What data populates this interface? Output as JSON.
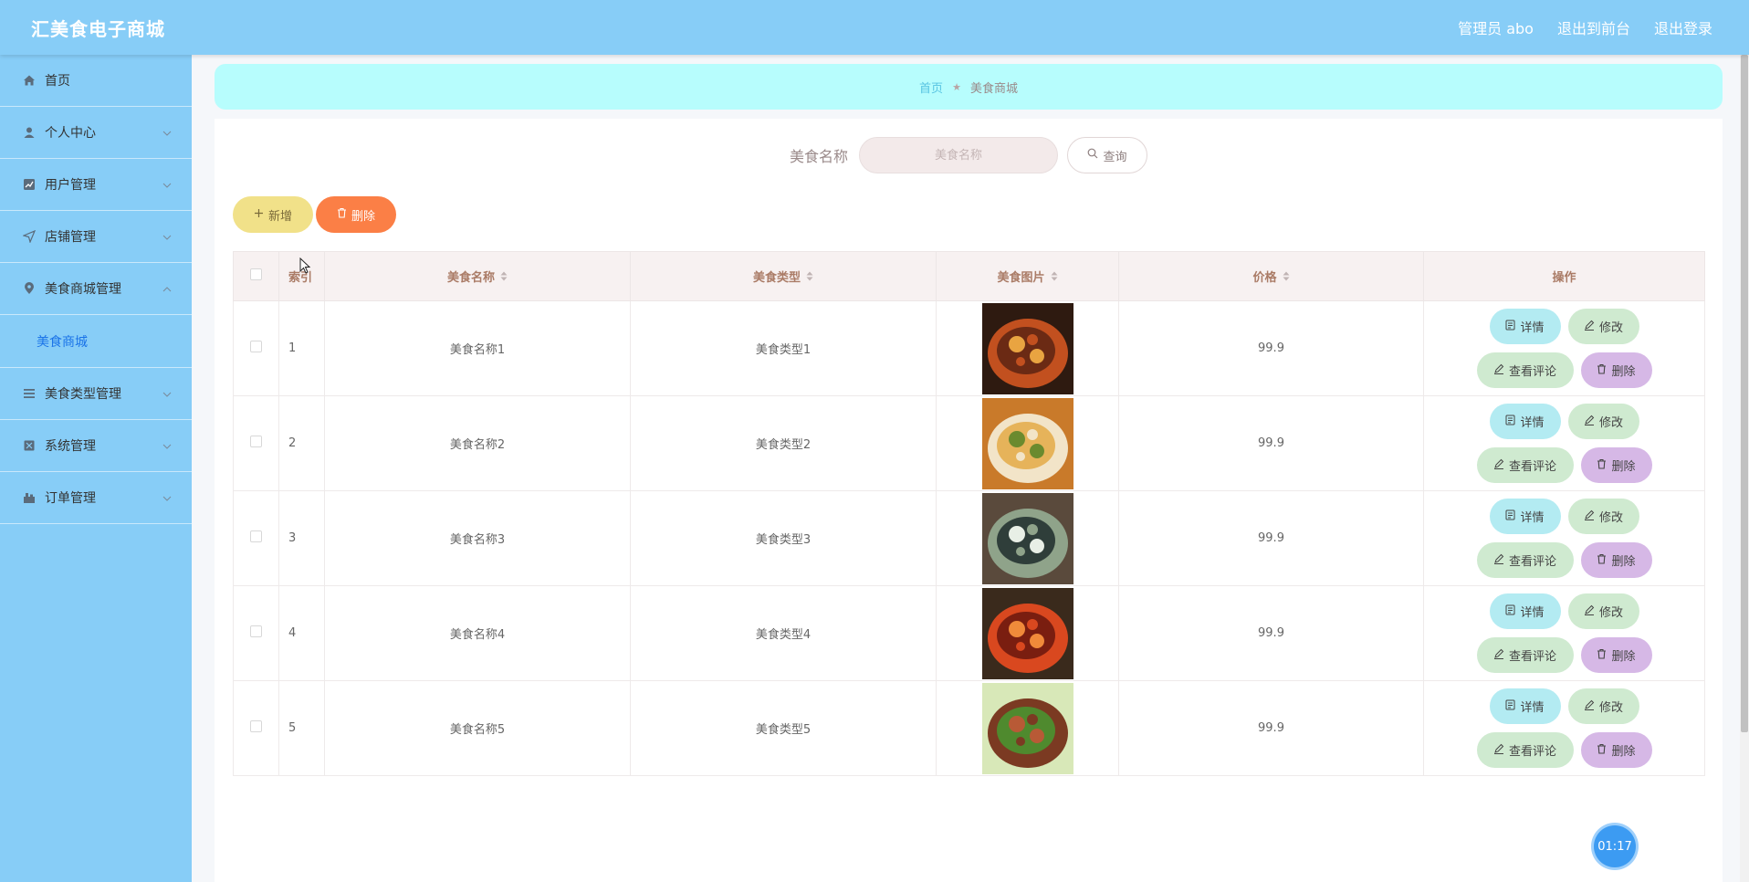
{
  "header": {
    "title": "汇美食电子商城",
    "admin_label": "管理员 abo",
    "to_front_label": "退出到前台",
    "logout_label": "退出登录"
  },
  "sidebar": {
    "items": [
      {
        "label": "首页",
        "icon": "home-icon"
      },
      {
        "label": "个人中心",
        "icon": "user-icon"
      },
      {
        "label": "用户管理",
        "icon": "chart-icon"
      },
      {
        "label": "店铺管理",
        "icon": "send-icon"
      },
      {
        "label": "美食商城管理",
        "icon": "location-icon",
        "expanded": true,
        "sub": "美食商城"
      },
      {
        "label": "美食类型管理",
        "icon": "menu-icon"
      },
      {
        "label": "系统管理",
        "icon": "box-icon"
      },
      {
        "label": "订单管理",
        "icon": "order-icon"
      }
    ]
  },
  "breadcrumb": {
    "home": "首页",
    "separator": "★",
    "current": "美食商城"
  },
  "search": {
    "label": "美食名称",
    "placeholder": "美食名称",
    "button_label": "查询"
  },
  "actions": {
    "add_label": "新增",
    "delete_label": "删除"
  },
  "table": {
    "headers": {
      "index": "索引",
      "name": "美食名称",
      "type": "美食类型",
      "image": "美食图片",
      "price": "价格",
      "ops": "操作"
    },
    "op_labels": {
      "detail": "详情",
      "edit": "修改",
      "comments": "查看评论",
      "delete": "删除"
    },
    "rows": [
      {
        "index": "1",
        "name": "美食名称1",
        "type": "美食类型1",
        "price": "99.9"
      },
      {
        "index": "2",
        "name": "美食名称2",
        "type": "美食类型2",
        "price": "99.9"
      },
      {
        "index": "3",
        "name": "美食名称3",
        "type": "美食类型3",
        "price": "99.9"
      },
      {
        "index": "4",
        "name": "美食名称4",
        "type": "美食类型4",
        "price": "99.9"
      },
      {
        "index": "5",
        "name": "美食名称5",
        "type": "美食类型5",
        "price": "99.9"
      }
    ]
  },
  "timer": "01:17",
  "colors": {
    "header": "#87cdf7",
    "breadcrumb_bg": "#b7fdfd",
    "add_button": "#f1e189",
    "delete_button": "#fb7f46",
    "detail_button": "#b3ebf2",
    "edit_button": "#cfead0",
    "row_delete_button": "#d6b8e6"
  }
}
